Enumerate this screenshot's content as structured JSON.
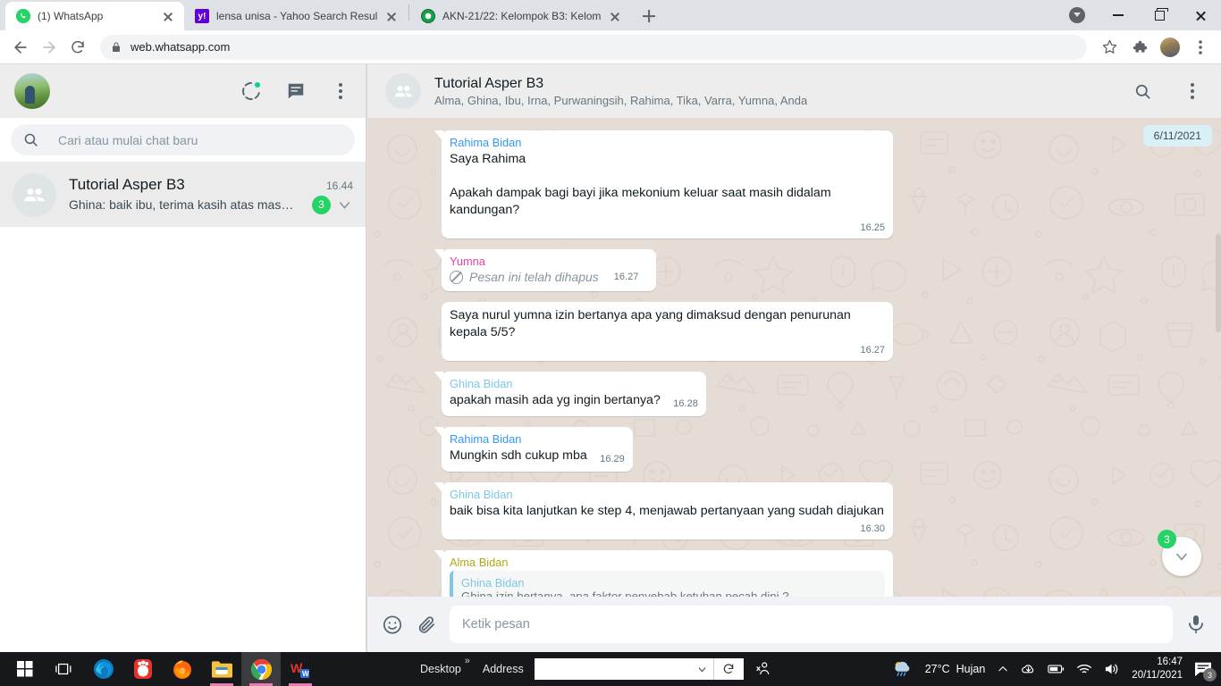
{
  "browser": {
    "tabs": [
      {
        "title": "(1) WhatsApp",
        "favicon": "whatsapp-icon",
        "active": true
      },
      {
        "title": "lensa unisa - Yahoo Search Result",
        "favicon": "yahoo-icon",
        "active": false
      },
      {
        "title": "AKN-21/22: Kelompok B3: Kelom",
        "favicon": "akn-icon",
        "active": false
      }
    ],
    "new_tab_label": "+",
    "url": "web.whatsapp.com",
    "nav": {
      "back": "back-arrow",
      "forward": "forward-arrow",
      "reload": "reload-icon"
    },
    "lock_icon": "lock-icon",
    "bookmark_icon": "star-icon",
    "extensions_icon": "puzzle-icon",
    "profile_icon": "profile-avatar",
    "menu_icon": "three-dot-menu",
    "window_controls": {
      "minimize": "minimize",
      "maximize": "maximize",
      "close": "close"
    }
  },
  "sidebar": {
    "avatar": "user-avatar",
    "icons": {
      "status": "status-circle-icon",
      "new_chat": "new-chat-icon",
      "menu": "menu-dots-icon"
    },
    "search": {
      "placeholder": "Cari atau mulai chat baru",
      "icon": "search-icon"
    },
    "chats": [
      {
        "name": "Tutorial Asper B3",
        "time": "16.44",
        "preview": "Ghina: baik ibu, terima kasih atas masuk...",
        "unread": "3",
        "avatar": "group-avatar"
      }
    ]
  },
  "chat_header": {
    "title": "Tutorial Asper B3",
    "members": "Alma, Ghina, Ibu, Irna, Purwaningsih, Rahima, Tika, Varra, Yumna, Anda",
    "search_icon": "search-icon",
    "menu_icon": "menu-dots-icon",
    "avatar": "group-avatar"
  },
  "conversation": {
    "date_chip": "6/11/2021",
    "messages": [
      {
        "sender": "Rahima Bidan",
        "sender_color": "c-blue",
        "text": "Saya Rahima\n\nApakah dampak bagi bayi jika mekonium keluar saat masih didalam kandungan?",
        "time": "16.25",
        "type": "text",
        "wide": true
      },
      {
        "sender": "Yumna",
        "sender_color": "c-pink",
        "text": "Pesan ini telah dihapus",
        "time": "16.27",
        "type": "deleted"
      },
      {
        "sender": "",
        "sender_color": "",
        "text": "Saya nurul yumna izin bertanya apa yang dimaksud dengan penurunan kepala 5/5?",
        "time": "16.27",
        "type": "text",
        "wide": true
      },
      {
        "sender": "Ghina Bidan",
        "sender_color": "c-cyan",
        "text": "apakah masih ada yg ingin bertanya?",
        "time": "16.28",
        "type": "text-inline"
      },
      {
        "sender": "Rahima Bidan",
        "sender_color": "c-blue",
        "text": "Mungkin sdh cukup mba",
        "time": "16.29",
        "type": "text-inline"
      },
      {
        "sender": "Ghina Bidan",
        "sender_color": "c-cyan",
        "text": "baik bisa kita lanjutkan ke step 4, menjawab pertanyaan yang sudah diajukan",
        "time": "16.30",
        "type": "text",
        "wide": true
      },
      {
        "sender": "Alma Bidan",
        "sender_color": "c-olive",
        "type": "quoted",
        "quote_name": "Ghina Bidan",
        "quote_text": "Ghina izin bertanya, apa faktor penyebab ketuban pecah dini ?",
        "text": "",
        "time": ""
      }
    ],
    "scroll_badge": "3",
    "scroll_icon": "chevron-down-icon"
  },
  "composer": {
    "emoji_icon": "emoji-icon",
    "attach_icon": "paperclip-icon",
    "mic_icon": "microphone-icon",
    "placeholder": "Ketik pesan"
  },
  "taskbar": {
    "start": "windows-start-icon",
    "taskview": "task-view-icon",
    "apps": [
      {
        "name": "edge-icon",
        "active": false,
        "underline": false
      },
      {
        "name": "gom-player-icon",
        "active": false,
        "underline": false
      },
      {
        "name": "firefox-icon",
        "active": false,
        "underline": false
      },
      {
        "name": "file-explorer-icon",
        "active": false,
        "underline": true
      },
      {
        "name": "chrome-icon",
        "active": true,
        "underline": true
      },
      {
        "name": "wps-office-icon",
        "active": false,
        "underline": true
      }
    ],
    "desktop_label": "Desktop",
    "address_label": "Address",
    "address_value": "",
    "refresh_icon": "refresh-icon",
    "people_icon": "people-icon",
    "weather": {
      "temp": "27°C",
      "condition": "Hujan",
      "icon": "rain-cloud-icon"
    },
    "tray_icons": [
      "chevron-up-icon",
      "onedrive-icon",
      "battery-icon",
      "wifi-icon",
      "volume-icon"
    ],
    "time": "16:47",
    "date": "20/11/2021",
    "notification_count": "3"
  }
}
